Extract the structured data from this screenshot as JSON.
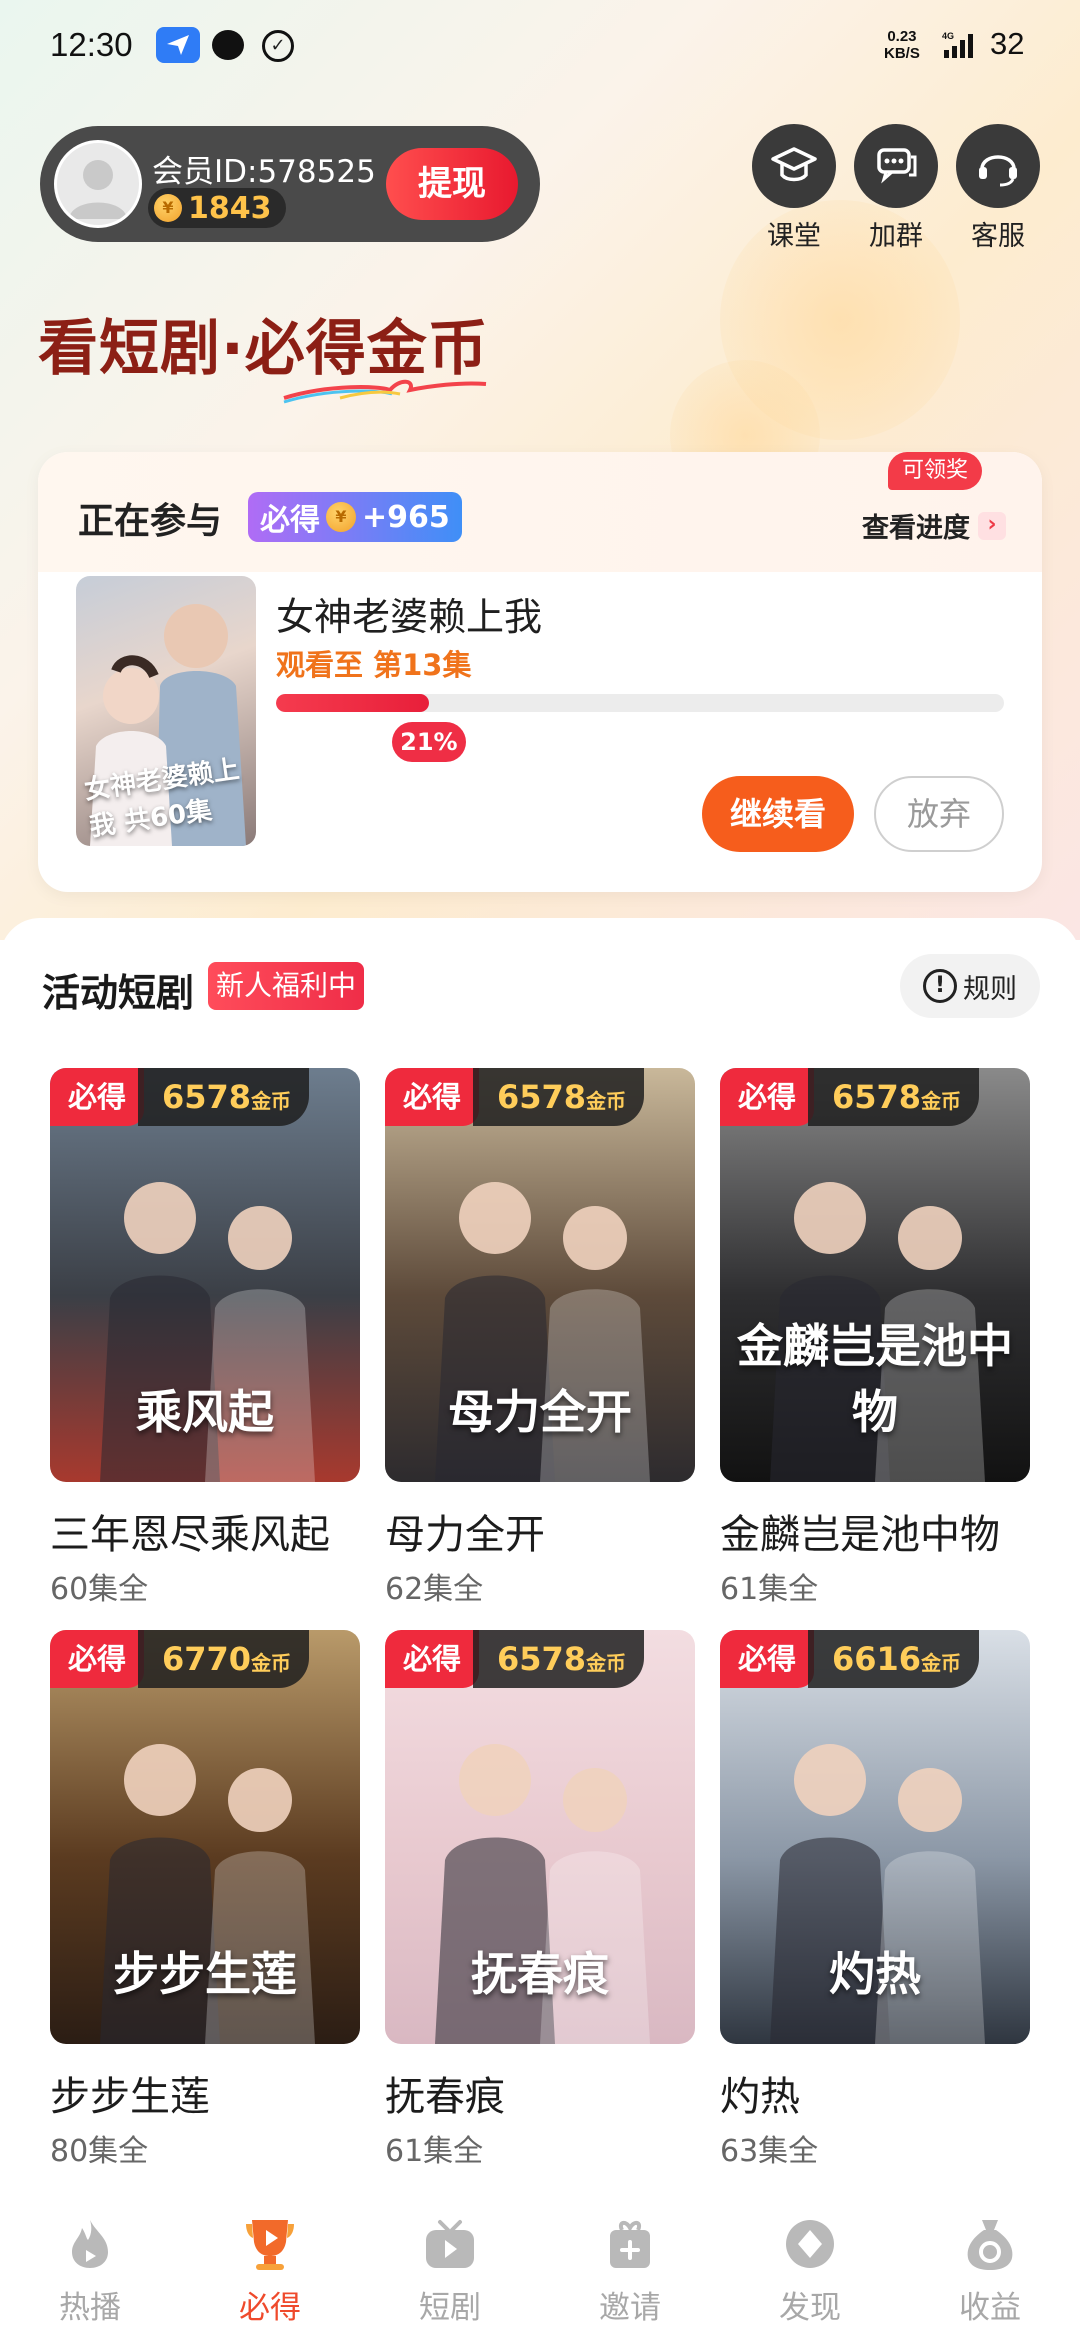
{
  "status_bar": {
    "time": "12:30",
    "speed_value": "0.23",
    "speed_unit": "KB/S",
    "network": "4G",
    "battery": "32"
  },
  "member": {
    "id_label": "会员ID:578525",
    "coins": "1843",
    "withdraw_label": "提现"
  },
  "top_icons": {
    "classroom": "课堂",
    "join_group": "加群",
    "service": "客服"
  },
  "headline": "看短剧·必得金币",
  "participating": {
    "title": "正在参与",
    "badge_prefix": "必得",
    "badge_value": "+965",
    "claimable_tag": "可领奖",
    "check_progress": "查看进度",
    "drama_title": "女神老婆赖上我",
    "watched_to": "观看至 第13集",
    "progress_pct": 21,
    "progress_label": "21%",
    "poster_text": "女神老婆赖上我 共60集",
    "continue_label": "继续看",
    "abandon_label": "放弃"
  },
  "activity": {
    "title": "活动短剧",
    "newbie_badge": "新人福利中",
    "rules_label": "规则",
    "bide_label": "必得",
    "coin_unit": "金币",
    "cards": [
      {
        "name": "三年恩尽乘风起",
        "eps": "60集全",
        "coins": "6578",
        "poster_title": "乘风起",
        "colors": [
          "#6d7d8e",
          "#3b3f46",
          "#a8392e"
        ]
      },
      {
        "name": "母力全开",
        "eps": "62集全",
        "coins": "6578",
        "poster_title": "母力全开",
        "colors": [
          "#c9b89a",
          "#5d4a3a",
          "#2d2b2e"
        ]
      },
      {
        "name": "金麟岂是池中物",
        "eps": "61集全",
        "coins": "6578",
        "poster_title": "金麟岂是池中物",
        "colors": [
          "#8a8a8a",
          "#2e2e30",
          "#121212"
        ]
      },
      {
        "name": "步步生莲",
        "eps": "80集全",
        "coins": "6770",
        "poster_title": "步步生莲",
        "colors": [
          "#b99a6a",
          "#5b3b20",
          "#2b1d14"
        ]
      },
      {
        "name": "抚春痕",
        "eps": "61集全",
        "coins": "6578",
        "poster_title": "抚春痕",
        "colors": [
          "#f3dde1",
          "#e8c9cf",
          "#d9b8c2"
        ]
      },
      {
        "name": "灼热",
        "eps": "63集全",
        "coins": "6616",
        "poster_title": "灼热",
        "colors": [
          "#d9dfe6",
          "#8b97a6",
          "#2f3640"
        ]
      }
    ]
  },
  "bottom_nav": [
    {
      "label": "热播",
      "icon": "flame-icon",
      "active": false
    },
    {
      "label": "必得",
      "icon": "trophy-play-icon",
      "active": true
    },
    {
      "label": "短剧",
      "icon": "tv-play-icon",
      "active": false
    },
    {
      "label": "邀请",
      "icon": "invite-gift-icon",
      "active": false
    },
    {
      "label": "发现",
      "icon": "discover-icon",
      "active": false
    },
    {
      "label": "收益",
      "icon": "money-bag-icon",
      "active": false
    }
  ],
  "colors": {
    "accent_red": "#ef2a3d",
    "accent_orange": "#f65d1c",
    "headline_brown": "#8c1f15",
    "coin_gold": "#ffcd5a",
    "nav_active": "#ef4a2c"
  }
}
